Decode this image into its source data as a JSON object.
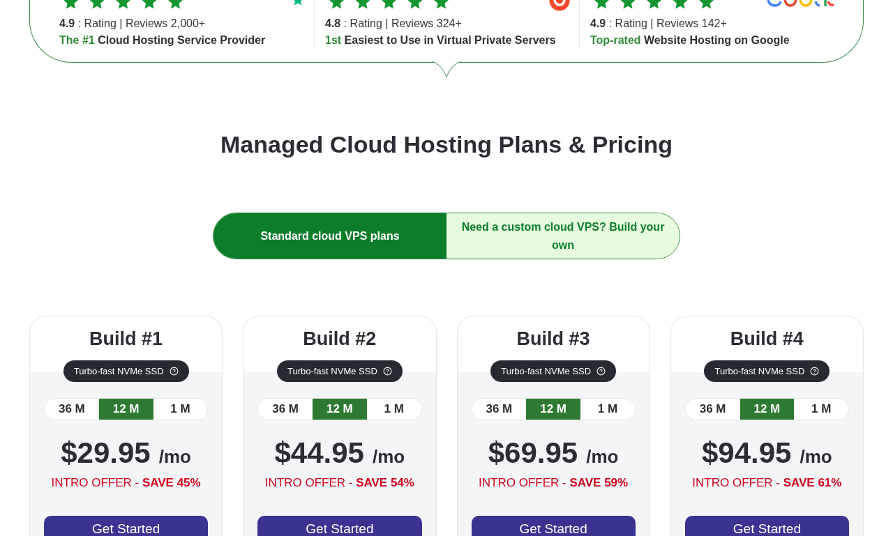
{
  "reviews": [
    {
      "stars": 5,
      "rating": "**4.9** : Rating | Reviews 2,000+",
      "highlight": "The #1",
      "tagline": "Cloud Hosting Service Provider"
    },
    {
      "stars": 5,
      "rating": "**4.8** : Rating | Reviews 324+",
      "highlight": "1st",
      "tagline": "Easiest to Use in Virtual Private Servers"
    },
    {
      "stars": 5,
      "rating": "**4.9** : Rating | Reviews 142+",
      "highlight": "Top-rated",
      "tagline": "Website Hosting on Google"
    }
  ],
  "heading": "Managed Cloud Hosting Plans & Pricing",
  "plan_toggle": [
    {
      "label": "Standard cloud VPS plans",
      "selected": true
    },
    {
      "label": "Need a custom cloud VPS? Build your own",
      "selected": false
    }
  ],
  "plans": [
    {
      "name": "Build #1",
      "badge": "Turbo-fast NVMe SSD",
      "periods": [
        {
          "label": "36 M",
          "selected": false
        },
        {
          "label": "12 M",
          "selected": true
        },
        {
          "label": "1 M",
          "selected": false
        }
      ],
      "price": "$29.95",
      "unit": "/mo",
      "offer": "INTRO OFFER - **SAVE 45%**",
      "button": "Get Started"
    },
    {
      "name": "Build #2",
      "badge": "Turbo-fast NVMe SSD",
      "periods": [
        {
          "label": "36 M",
          "selected": false
        },
        {
          "label": "12 M",
          "selected": true
        },
        {
          "label": "1 M",
          "selected": false
        }
      ],
      "price": "$44.95",
      "unit": "/mo",
      "offer": "INTRO OFFER - **SAVE 54%**",
      "button": "Get Started"
    },
    {
      "name": "Build #3",
      "badge": "Turbo-fast NVMe SSD",
      "periods": [
        {
          "label": "36 M",
          "selected": false
        },
        {
          "label": "12 M",
          "selected": true
        },
        {
          "label": "1 M",
          "selected": false
        }
      ],
      "price": "$69.95",
      "unit": "/mo",
      "offer": "INTRO OFFER - **SAVE 59%**",
      "button": "Get Started"
    },
    {
      "name": "Build #4",
      "badge": "Turbo-fast NVMe SSD",
      "periods": [
        {
          "label": "36 M",
          "selected": false
        },
        {
          "label": "12 M",
          "selected": true
        },
        {
          "label": "1 M",
          "selected": false
        }
      ],
      "price": "$94.95",
      "unit": "/mo",
      "offer": "INTRO OFFER - **SAVE 61%**",
      "button": "Get Started"
    }
  ]
}
